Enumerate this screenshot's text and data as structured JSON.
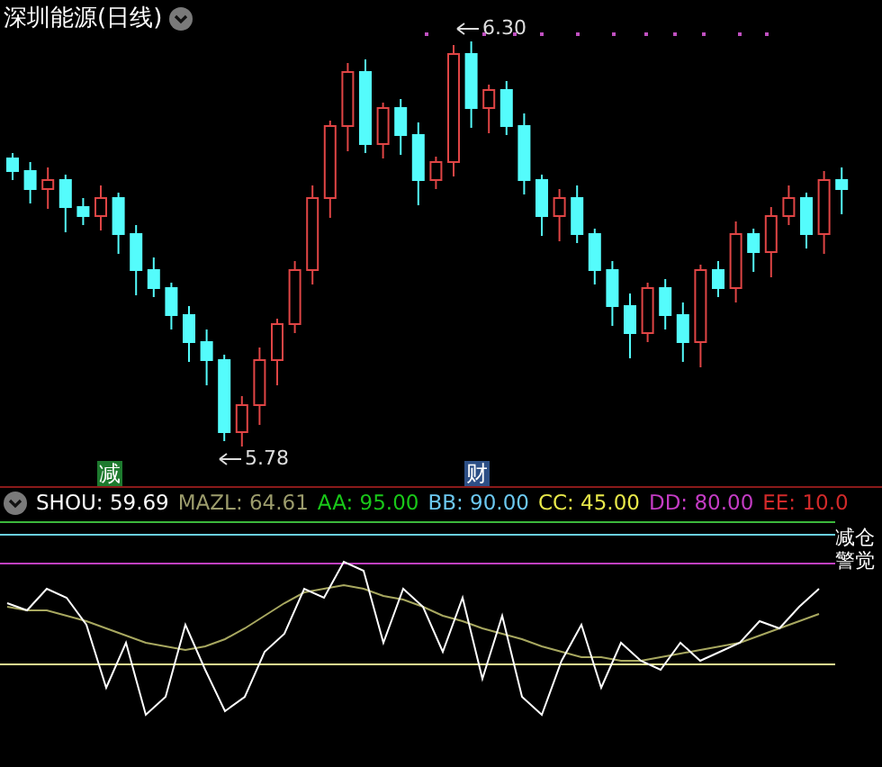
{
  "title": "深圳能源(日线)",
  "price_marks": [
    {
      "kind": "high",
      "text": "6.30"
    },
    {
      "kind": "low",
      "text": "5.78"
    }
  ],
  "signals": [
    {
      "text": "减",
      "color": "#1d7a2e"
    },
    {
      "text": "财",
      "color": "#2d4f86"
    }
  ],
  "indicator": {
    "values": [
      {
        "text": "SHOU: 59.69",
        "color": "#ffffff"
      },
      {
        "text": "MAZL: 64.61",
        "color": "#9c9c6c"
      },
      {
        "text": "AA: 95.00",
        "color": "#19c819"
      },
      {
        "text": "BB: 90.00",
        "color": "#6cc8f0"
      },
      {
        "text": "CC: 45.00",
        "color": "#e8e84a"
      },
      {
        "text": "DD: 80.00",
        "color": "#c43cc4"
      },
      {
        "text": "EE: 10.0",
        "color": "#d22a2a"
      }
    ],
    "line_labels": [
      "减仓",
      "警觉"
    ]
  }
}
